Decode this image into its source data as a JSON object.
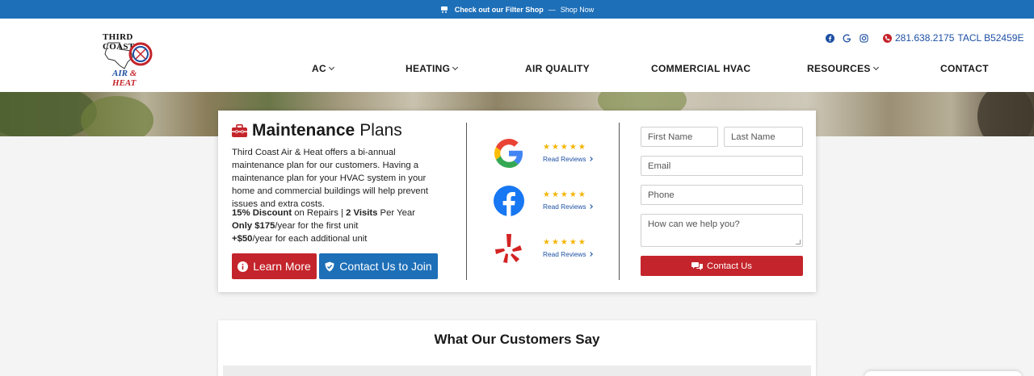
{
  "topbar": {
    "icon": "shopping-cart-icon",
    "link_text": "Check out our Filter Shop",
    "separator": "—",
    "shop_now": "Shop Now",
    "bg_color": "#1d6fb8"
  },
  "logo": {
    "line1": "THIRD COAST",
    "line2_a": "AIR",
    "line2_amp": "&",
    "line2_b": "HEAT"
  },
  "header": {
    "social_icons": [
      "facebook-icon",
      "google-icon",
      "instagram-icon"
    ],
    "phone": "281.638.2175",
    "license": "TACL B52459E"
  },
  "nav": {
    "items": [
      {
        "label": "AC",
        "dropdown": true
      },
      {
        "label": "HEATING",
        "dropdown": true
      },
      {
        "label": "AIR QUALITY",
        "dropdown": false
      },
      {
        "label": "COMMERCIAL HVAC",
        "dropdown": false
      },
      {
        "label": "RESOURCES",
        "dropdown": true
      },
      {
        "label": "CONTACT",
        "dropdown": false
      }
    ]
  },
  "plans": {
    "title_bold": "Maintenance",
    "title_light": "Plans",
    "description": "Third Coast Air & Heat offers a bi-annual maintenance plan for our customers. Having a maintenance plan for your HVAC system in your home and commercial buildings will help prevent issues and extra costs.",
    "offer1_bold": "15% Discount",
    "offer1_mid": " on Repairs | ",
    "offer1_bold2": "2 Visits",
    "offer1_end": " Per Year",
    "offer2_bold": "Only $175",
    "offer2_end": "/year for the first unit",
    "offer3_bold": "+$50",
    "offer3_end": "/year for each additional unit",
    "learn_more": "Learn More",
    "contact_join": "Contact Us to Join"
  },
  "reviews": {
    "stars": "★★★★★",
    "link_label": "Read Reviews",
    "platforms": [
      "google-logo-icon",
      "facebook-logo-icon",
      "yelp-logo-icon"
    ]
  },
  "form": {
    "first_name": "First Name",
    "last_name": "Last Name",
    "email": "Email",
    "phone": "Phone",
    "message": "How can we help you?",
    "submit": "Contact Us"
  },
  "customers": {
    "heading": "What Our Customers Say"
  },
  "colors": {
    "brand_red": "#c4242b",
    "brand_blue": "#1d6fb8",
    "star_gold": "#f5b400"
  }
}
